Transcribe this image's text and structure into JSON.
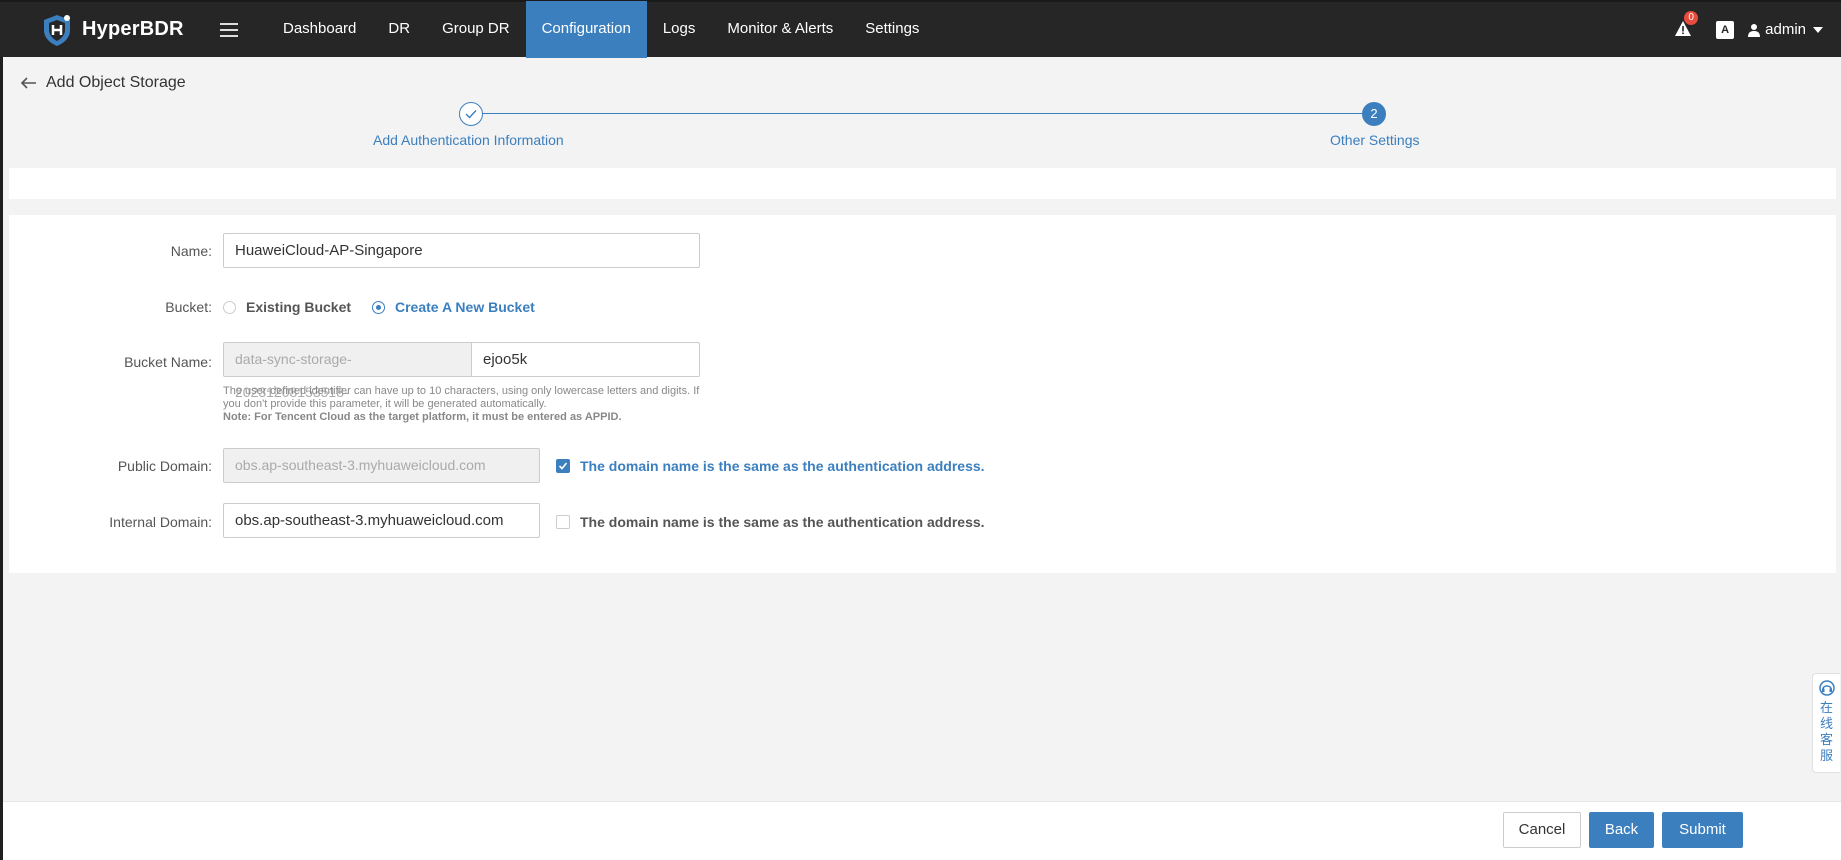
{
  "app": {
    "brand": "HyperBDR",
    "nav": [
      {
        "label": "Dashboard",
        "active": false
      },
      {
        "label": "DR",
        "active": false
      },
      {
        "label": "Group DR",
        "active": false
      },
      {
        "label": "Configuration",
        "active": true
      },
      {
        "label": "Logs",
        "active": false
      },
      {
        "label": "Monitor & Alerts",
        "active": false
      },
      {
        "label": "Settings",
        "active": false
      }
    ],
    "alert_count": "0",
    "lang_icon": "A",
    "user": "admin"
  },
  "page": {
    "title": "Add Object Storage"
  },
  "stepper": {
    "steps": [
      {
        "label": "Add Authentication Information",
        "status": "done"
      },
      {
        "label": "Other Settings",
        "number": "2",
        "status": "active"
      }
    ]
  },
  "form": {
    "name": {
      "label": "Name:",
      "value": "HuaweiCloud-AP-Singapore"
    },
    "bucket": {
      "label": "Bucket:",
      "options": [
        {
          "label": "Existing Bucket",
          "checked": false
        },
        {
          "label": "Create A New Bucket",
          "checked": true
        }
      ]
    },
    "bucket_name": {
      "label": "Bucket Name:",
      "prefix": "data-sync-storage-20231208153518-",
      "value": "ejoo5k",
      "hint": "The user-defined identifier can have up to 10 characters, using only lowercase letters and digits. If you don't provide this parameter, it will be generated automatically.",
      "note": "Note: For Tencent Cloud as the target platform, it must be entered as APPID."
    },
    "public_domain": {
      "label": "Public Domain:",
      "value": "obs.ap-southeast-3.myhuaweicloud.com",
      "same_as_auth": true,
      "checkbox_label": "The domain name is the same as the authentication address."
    },
    "internal_domain": {
      "label": "Internal Domain:",
      "value": "obs.ap-southeast-3.myhuaweicloud.com",
      "same_as_auth": false,
      "checkbox_label": "The domain name is the same as the authentication address."
    }
  },
  "footer": {
    "cancel": "Cancel",
    "back": "Back",
    "submit": "Submit"
  },
  "support": {
    "label": "在线客服"
  },
  "colors": {
    "accent": "#3b7fbf",
    "topbar": "#262626",
    "badge": "#e74c3c"
  },
  "icons": [
    "shield-logo-icon",
    "menu-icon",
    "alert-icon",
    "translate-icon",
    "user-icon",
    "chevron-down-icon",
    "back-arrow-icon",
    "check-icon",
    "headset-icon"
  ]
}
